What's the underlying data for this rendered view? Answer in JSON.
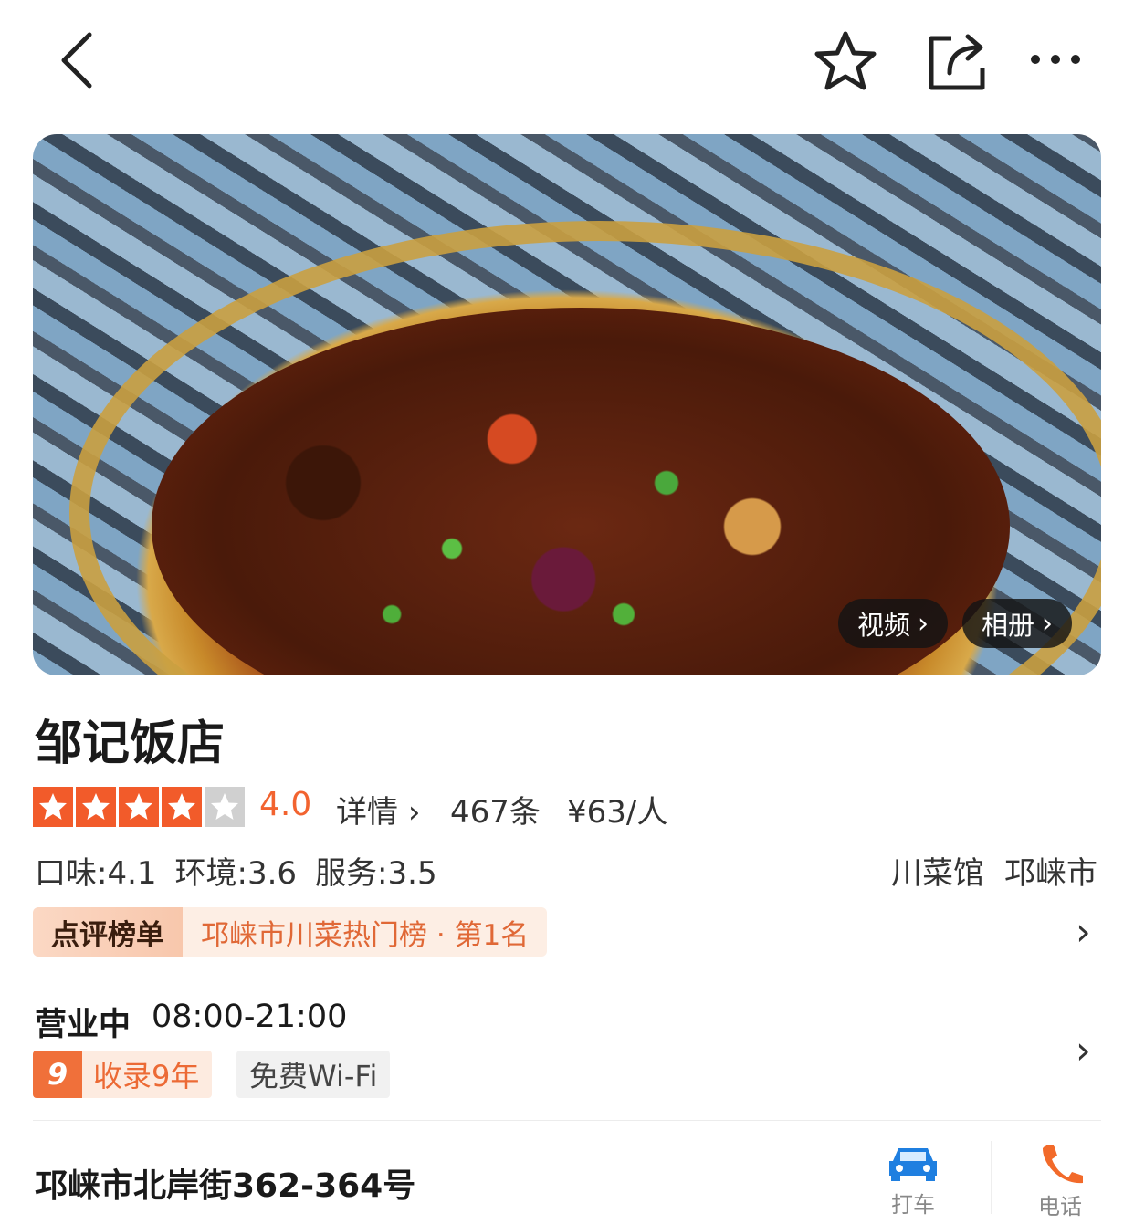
{
  "nav": {
    "back_icon": "back-icon",
    "favorite_icon": "star-outline-icon",
    "share_icon": "share-icon",
    "more_icon": "more-icon"
  },
  "hero": {
    "video_label": "视频",
    "album_label": "相册"
  },
  "shop": {
    "name": "邹记饭店",
    "star_rating": 4,
    "star_max": 5,
    "rating_text": "4.0",
    "detail_label": "详情",
    "review_count": "467条",
    "avg_price": "¥63/人",
    "scores": [
      {
        "text": "口味:4.1"
      },
      {
        "text": "环境:3.6"
      },
      {
        "text": "服务:3.5"
      }
    ],
    "category": "川菜馆",
    "area": "邛崃市"
  },
  "ranking": {
    "tag": "点评榜单",
    "text": "邛崃市川菜热门榜 · 第1名"
  },
  "hours": {
    "status": "营业中",
    "time": "08:00-21:00"
  },
  "tags": {
    "years_badge": "9",
    "years_text": "收录9年",
    "wifi": "免费Wi-Fi"
  },
  "address": {
    "text": "邛崃市北岸街362-364号",
    "taxi_label": "打车",
    "call_label": "电话"
  },
  "colors": {
    "accent": "#f25b2a",
    "rating": "#f2632f",
    "star_off": "#d0d0d0"
  }
}
